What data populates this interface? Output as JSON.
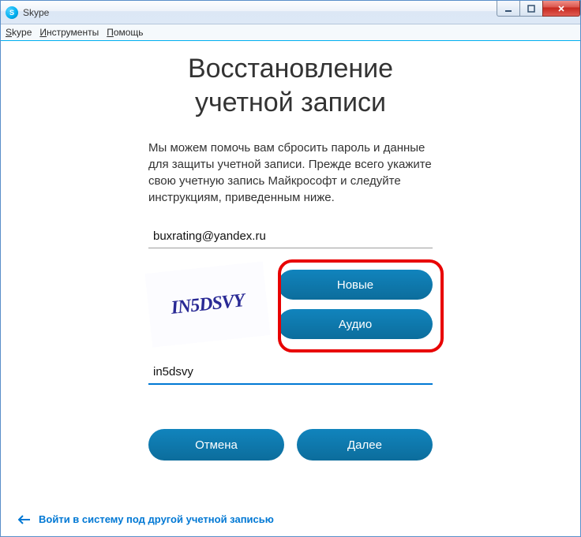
{
  "window": {
    "title": "Skype"
  },
  "menu": {
    "items": [
      "Skype",
      "Инструменты",
      "Помощь"
    ]
  },
  "page": {
    "title_line1": "Восстановление",
    "title_line2": "учетной записи",
    "help_text": "Мы можем помочь вам сбросить пароль и данные для защиты учетной записи. Прежде всего укажите свою учетную запись Майкрософт и следуйте инструкциям, приведенным ниже."
  },
  "fields": {
    "email_value": "buxrating@yandex.ru",
    "captcha_value": "in5dsvy"
  },
  "captcha": {
    "image_text": "IN5DSVY",
    "new_label": "Новые",
    "audio_label": "Аудио"
  },
  "actions": {
    "cancel": "Отмена",
    "next": "Далее"
  },
  "footer": {
    "other_account": "Войти в систему под другой учетной записью"
  },
  "colors": {
    "accent": "#0078d4",
    "button": "#0f6e9e",
    "highlight": "#e80202"
  }
}
